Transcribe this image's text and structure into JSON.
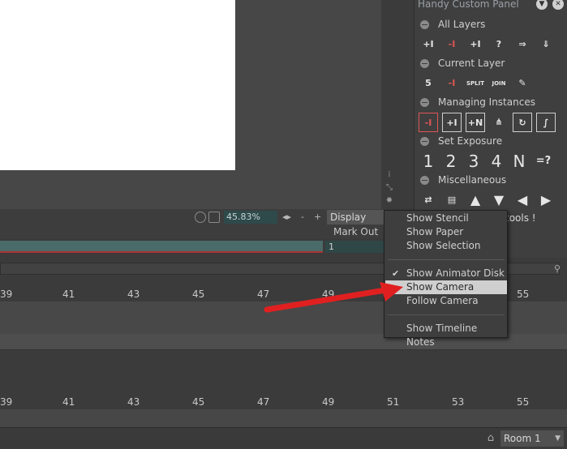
{
  "viewer": {
    "zoom": "45.83%",
    "minus": "-",
    "plus": "+",
    "nav_arrows": "◂▸",
    "display_label": "Display",
    "mark_out_label": "Mark Out",
    "frame_value": "1"
  },
  "ruler": {
    "top": [
      "39",
      "41",
      "43",
      "45",
      "47",
      "49",
      "55"
    ],
    "bottom": [
      "39",
      "41",
      "43",
      "45",
      "47",
      "49",
      "51",
      "53",
      "55"
    ]
  },
  "panel": {
    "title": "Handy Custom Panel",
    "sections": {
      "all_layers": "All Layers",
      "current_layer": "Current Layer",
      "managing_instances": "Managing Instances",
      "set_exposure": "Set Exposure",
      "miscellaneous": "Miscellaneous"
    },
    "exposure_buttons": [
      "1",
      "2",
      "3",
      "4",
      "N",
      "=?"
    ],
    "current_layer_buttons": [
      "5",
      "-I",
      "SPLIT",
      "JOIN"
    ],
    "tools_label": "tools !"
  },
  "menu": {
    "items": {
      "show_stencil": "Show Stencil",
      "show_paper": "Show Paper",
      "show_selection": "Show Selection",
      "show_animator_disk": "Show Animator Disk",
      "show_camera": "Show Camera",
      "follow_camera": "Follow Camera",
      "show_timeline_notes": "Show Timeline Notes"
    },
    "checked": [
      "show_animator_disk"
    ],
    "highlighted": "show_camera"
  },
  "footer": {
    "room": "Room 1"
  },
  "colors": {
    "accent_red": "#e02020",
    "menu_highlight": "#cfcfcf",
    "zoom_field": "#2e4a4a"
  }
}
